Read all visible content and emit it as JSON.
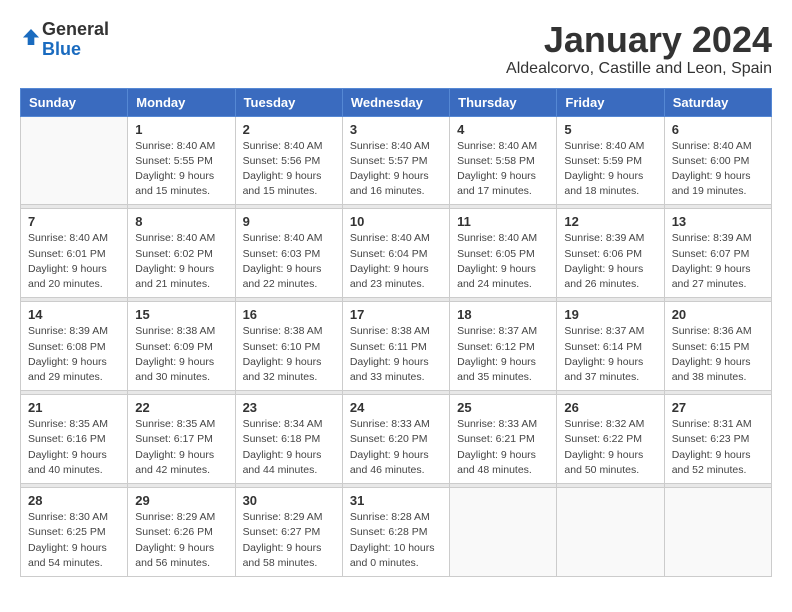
{
  "logo": {
    "general": "General",
    "blue": "Blue"
  },
  "title": "January 2024",
  "subtitle": "Aldealcorvo, Castille and Leon, Spain",
  "weekdays": [
    "Sunday",
    "Monday",
    "Tuesday",
    "Wednesday",
    "Thursday",
    "Friday",
    "Saturday"
  ],
  "weeks": [
    [
      {
        "day": "",
        "info": ""
      },
      {
        "day": "1",
        "info": "Sunrise: 8:40 AM\nSunset: 5:55 PM\nDaylight: 9 hours\nand 15 minutes."
      },
      {
        "day": "2",
        "info": "Sunrise: 8:40 AM\nSunset: 5:56 PM\nDaylight: 9 hours\nand 15 minutes."
      },
      {
        "day": "3",
        "info": "Sunrise: 8:40 AM\nSunset: 5:57 PM\nDaylight: 9 hours\nand 16 minutes."
      },
      {
        "day": "4",
        "info": "Sunrise: 8:40 AM\nSunset: 5:58 PM\nDaylight: 9 hours\nand 17 minutes."
      },
      {
        "day": "5",
        "info": "Sunrise: 8:40 AM\nSunset: 5:59 PM\nDaylight: 9 hours\nand 18 minutes."
      },
      {
        "day": "6",
        "info": "Sunrise: 8:40 AM\nSunset: 6:00 PM\nDaylight: 9 hours\nand 19 minutes."
      }
    ],
    [
      {
        "day": "7",
        "info": "Sunrise: 8:40 AM\nSunset: 6:01 PM\nDaylight: 9 hours\nand 20 minutes."
      },
      {
        "day": "8",
        "info": "Sunrise: 8:40 AM\nSunset: 6:02 PM\nDaylight: 9 hours\nand 21 minutes."
      },
      {
        "day": "9",
        "info": "Sunrise: 8:40 AM\nSunset: 6:03 PM\nDaylight: 9 hours\nand 22 minutes."
      },
      {
        "day": "10",
        "info": "Sunrise: 8:40 AM\nSunset: 6:04 PM\nDaylight: 9 hours\nand 23 minutes."
      },
      {
        "day": "11",
        "info": "Sunrise: 8:40 AM\nSunset: 6:05 PM\nDaylight: 9 hours\nand 24 minutes."
      },
      {
        "day": "12",
        "info": "Sunrise: 8:39 AM\nSunset: 6:06 PM\nDaylight: 9 hours\nand 26 minutes."
      },
      {
        "day": "13",
        "info": "Sunrise: 8:39 AM\nSunset: 6:07 PM\nDaylight: 9 hours\nand 27 minutes."
      }
    ],
    [
      {
        "day": "14",
        "info": "Sunrise: 8:39 AM\nSunset: 6:08 PM\nDaylight: 9 hours\nand 29 minutes."
      },
      {
        "day": "15",
        "info": "Sunrise: 8:38 AM\nSunset: 6:09 PM\nDaylight: 9 hours\nand 30 minutes."
      },
      {
        "day": "16",
        "info": "Sunrise: 8:38 AM\nSunset: 6:10 PM\nDaylight: 9 hours\nand 32 minutes."
      },
      {
        "day": "17",
        "info": "Sunrise: 8:38 AM\nSunset: 6:11 PM\nDaylight: 9 hours\nand 33 minutes."
      },
      {
        "day": "18",
        "info": "Sunrise: 8:37 AM\nSunset: 6:12 PM\nDaylight: 9 hours\nand 35 minutes."
      },
      {
        "day": "19",
        "info": "Sunrise: 8:37 AM\nSunset: 6:14 PM\nDaylight: 9 hours\nand 37 minutes."
      },
      {
        "day": "20",
        "info": "Sunrise: 8:36 AM\nSunset: 6:15 PM\nDaylight: 9 hours\nand 38 minutes."
      }
    ],
    [
      {
        "day": "21",
        "info": "Sunrise: 8:35 AM\nSunset: 6:16 PM\nDaylight: 9 hours\nand 40 minutes."
      },
      {
        "day": "22",
        "info": "Sunrise: 8:35 AM\nSunset: 6:17 PM\nDaylight: 9 hours\nand 42 minutes."
      },
      {
        "day": "23",
        "info": "Sunrise: 8:34 AM\nSunset: 6:18 PM\nDaylight: 9 hours\nand 44 minutes."
      },
      {
        "day": "24",
        "info": "Sunrise: 8:33 AM\nSunset: 6:20 PM\nDaylight: 9 hours\nand 46 minutes."
      },
      {
        "day": "25",
        "info": "Sunrise: 8:33 AM\nSunset: 6:21 PM\nDaylight: 9 hours\nand 48 minutes."
      },
      {
        "day": "26",
        "info": "Sunrise: 8:32 AM\nSunset: 6:22 PM\nDaylight: 9 hours\nand 50 minutes."
      },
      {
        "day": "27",
        "info": "Sunrise: 8:31 AM\nSunset: 6:23 PM\nDaylight: 9 hours\nand 52 minutes."
      }
    ],
    [
      {
        "day": "28",
        "info": "Sunrise: 8:30 AM\nSunset: 6:25 PM\nDaylight: 9 hours\nand 54 minutes."
      },
      {
        "day": "29",
        "info": "Sunrise: 8:29 AM\nSunset: 6:26 PM\nDaylight: 9 hours\nand 56 minutes."
      },
      {
        "day": "30",
        "info": "Sunrise: 8:29 AM\nSunset: 6:27 PM\nDaylight: 9 hours\nand 58 minutes."
      },
      {
        "day": "31",
        "info": "Sunrise: 8:28 AM\nSunset: 6:28 PM\nDaylight: 10 hours\nand 0 minutes."
      },
      {
        "day": "",
        "info": ""
      },
      {
        "day": "",
        "info": ""
      },
      {
        "day": "",
        "info": ""
      }
    ]
  ]
}
